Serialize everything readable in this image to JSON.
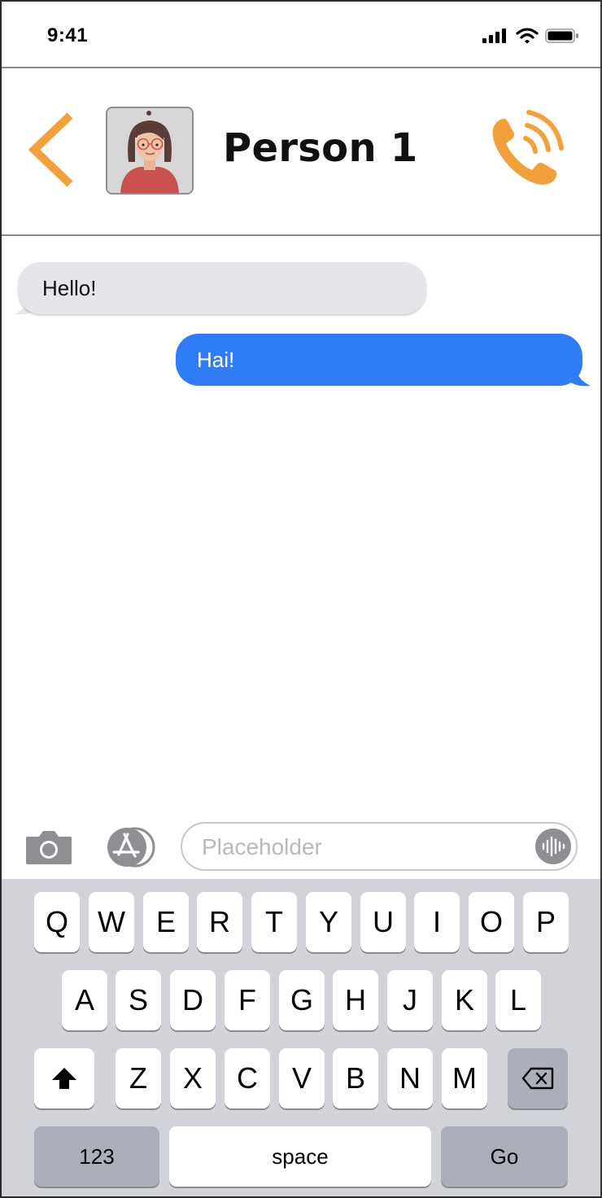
{
  "status_bar": {
    "time": "9:41",
    "signal_icon": "cellular-signal-icon",
    "wifi_icon": "wifi-icon",
    "battery_icon": "battery-icon"
  },
  "header": {
    "back_icon": "chevron-left-icon",
    "contact_name": "Person 1",
    "call_icon": "phone-call-icon",
    "accent_color": "#f2a03b"
  },
  "messages": [
    {
      "direction": "incoming",
      "text": "Hello!"
    },
    {
      "direction": "outgoing",
      "text": "Hai!"
    }
  ],
  "input_bar": {
    "camera_icon": "camera-icon",
    "apps_icon": "app-store-icon",
    "placeholder": "Placeholder",
    "value": "",
    "voice_icon": "voice-waveform-icon"
  },
  "keyboard": {
    "row1": [
      "Q",
      "W",
      "E",
      "R",
      "T",
      "Y",
      "U",
      "I",
      "O",
      "P"
    ],
    "row2": [
      "A",
      "S",
      "D",
      "F",
      "G",
      "H",
      "J",
      "K",
      "L"
    ],
    "row3": [
      "Z",
      "X",
      "C",
      "V",
      "B",
      "N",
      "M"
    ],
    "shift_icon": "shift-arrow-icon",
    "delete_icon": "backspace-icon",
    "numbers_label": "123",
    "space_label": "space",
    "go_label": "Go"
  },
  "colors": {
    "outgoing_bubble": "#2f7cf6",
    "incoming_bubble": "#e5e5ea",
    "keyboard_bg": "#d1d3d9"
  }
}
